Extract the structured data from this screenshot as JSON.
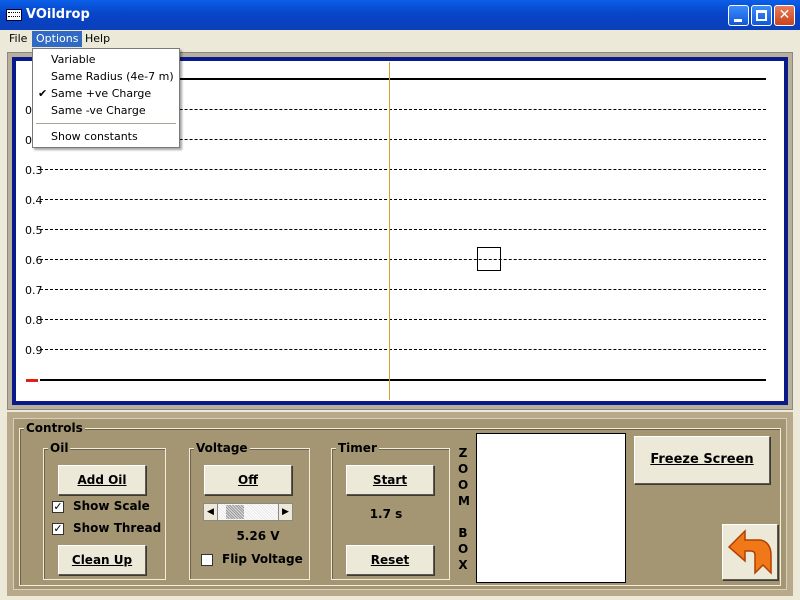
{
  "window": {
    "title": "VOildrop"
  },
  "menubar": {
    "file": "File",
    "options": "Options",
    "help": "Help"
  },
  "options_menu": {
    "items": [
      {
        "label": "Variable",
        "checked": false
      },
      {
        "label": "Same Radius (4e-7 m)",
        "checked": false
      },
      {
        "label": "Same +ve Charge",
        "checked": true
      },
      {
        "label": "Same -ve Charge",
        "checked": false
      },
      {
        "label": "Show constants",
        "checked": false
      }
    ],
    "check_glyph": "✔"
  },
  "scale": {
    "ticks": [
      "0.3",
      "0.4",
      "0.5",
      "0.6",
      "0.7",
      "0.8",
      "0.9"
    ],
    "partial_ticks": [
      "0",
      "0"
    ]
  },
  "controls": {
    "title": "Controls",
    "oil": {
      "title": "Oil",
      "add_oil": "Add Oil",
      "show_scale": "Show Scale",
      "show_scale_checked": true,
      "show_thread": "Show Thread",
      "show_thread_checked": true,
      "clean_up": "Clean Up"
    },
    "voltage": {
      "title": "Voltage",
      "off_button": "Off",
      "value": "5.26 V",
      "flip_voltage": "Flip Voltage",
      "flip_checked": false
    },
    "timer": {
      "title": "Timer",
      "start": "Start",
      "time": "1.7 s",
      "reset": "Reset"
    },
    "zoom_label": [
      "Z",
      "O",
      "O",
      "M",
      "B",
      "O",
      "X"
    ],
    "freeze_screen": "Freeze Screen"
  },
  "colors": {
    "thread": "#d4a020",
    "scale_marker": "#e0201a",
    "plot_border": "#0a1a8a",
    "panel": "#a49673",
    "back_arrow": "#f07818"
  },
  "icons": {
    "back": "back-arrow-icon",
    "app": "app-window-icon"
  }
}
